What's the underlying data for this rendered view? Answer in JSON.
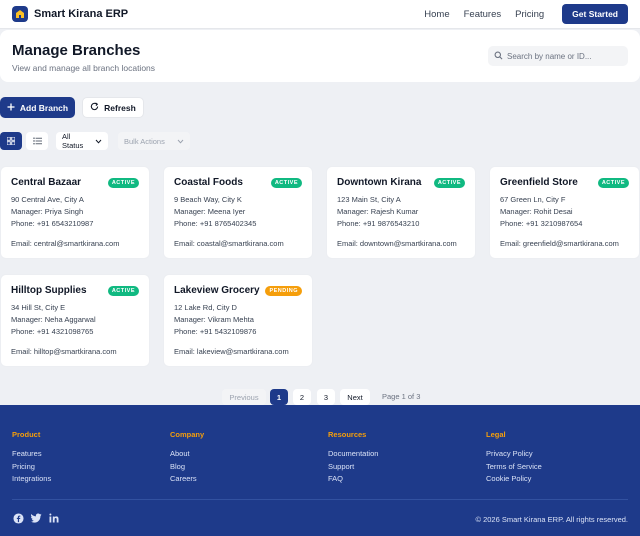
{
  "nav": {
    "brand": "Smart Kirana ERP",
    "links": [
      "Home",
      "Features",
      "Pricing"
    ],
    "cta": "Get Started"
  },
  "header": {
    "title": "Manage Branches",
    "subtitle": "View and manage all branch locations",
    "search_placeholder": "Search by name or ID..."
  },
  "actions": {
    "add": "Add Branch",
    "refresh": "Refresh"
  },
  "toolbar": {
    "status_filter": "All Status",
    "bulk_actions": "Bulk Actions"
  },
  "branches": [
    {
      "name": "Central Bazaar",
      "status": "ACTIVE",
      "address": "90 Central Ave, City A",
      "manager": "Manager: Priya Singh",
      "phone": "Phone: +91 6543210987",
      "email": "Email: central@smartkirana.com"
    },
    {
      "name": "Coastal Foods",
      "status": "ACTIVE",
      "address": "9 Beach Way, City K",
      "manager": "Manager: Meena Iyer",
      "phone": "Phone: +91 8765402345",
      "email": "Email: coastal@smartkirana.com"
    },
    {
      "name": "Downtown Kirana",
      "status": "ACTIVE",
      "address": "123 Main St, City A",
      "manager": "Manager: Rajesh Kumar",
      "phone": "Phone: +91 9876543210",
      "email": "Email: downtown@smartkirana.com"
    },
    {
      "name": "Greenfield Store",
      "status": "ACTIVE",
      "address": "67 Green Ln, City F",
      "manager": "Manager: Rohit Desai",
      "phone": "Phone: +91 3210987654",
      "email": "Email: greenfield@smartkirana.com"
    },
    {
      "name": "Hilltop Supplies",
      "status": "ACTIVE",
      "address": "34 Hill St, City E",
      "manager": "Manager: Neha Aggarwal",
      "phone": "Phone: +91 4321098765",
      "email": "Email: hilltop@smartkirana.com"
    },
    {
      "name": "Lakeview Grocery",
      "status": "PENDING",
      "address": "12 Lake Rd, City D",
      "manager": "Manager: Vikram Mehta",
      "phone": "Phone: +91 5432109876",
      "email": "Email: lakeview@smartkirana.com"
    }
  ],
  "pagination": {
    "prev": "Previous",
    "pages": [
      "1",
      "2",
      "3"
    ],
    "next": "Next",
    "info": "Page 1 of 3"
  },
  "footer": {
    "columns": [
      {
        "heading": "Product",
        "links": [
          "Features",
          "Pricing",
          "Integrations"
        ]
      },
      {
        "heading": "Company",
        "links": [
          "About",
          "Blog",
          "Careers"
        ]
      },
      {
        "heading": "Resources",
        "links": [
          "Documentation",
          "Support",
          "FAQ"
        ]
      },
      {
        "heading": "Legal",
        "links": [
          "Privacy Policy",
          "Terms of Service",
          "Cookie Policy"
        ]
      }
    ],
    "copyright": "© 2026 Smart Kirana ERP. All rights reserved.",
    "social_icons": [
      "facebook-icon",
      "twitter-icon",
      "linkedin-icon"
    ]
  },
  "colors": {
    "primary": "#1e3a8a",
    "active": "#10b981",
    "pending": "#f59e0b",
    "footer_heading": "#f59e0b"
  }
}
